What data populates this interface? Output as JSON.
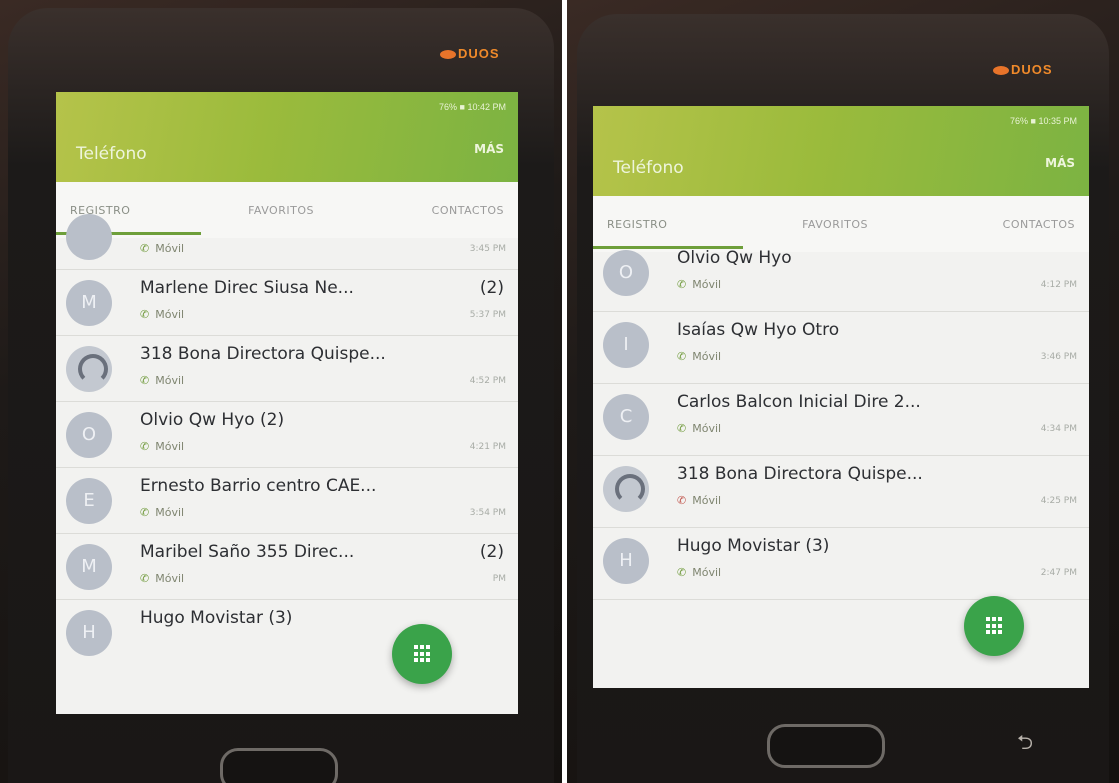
{
  "left_photo": {
    "brand_badge": "DUOS",
    "status_bar": "76% ■ 10:42 PM",
    "app_title": "Teléfono",
    "more_label": "MÁS",
    "tabs": [
      "REGISTRO",
      "FAVORITOS",
      "CONTACTOS"
    ],
    "active_tab": "REGISTRO",
    "entries": [
      {
        "avatar": "",
        "name": "",
        "type": "Móvil",
        "time": "3:45 PM",
        "count": ""
      },
      {
        "avatar": "M",
        "name": "Marlene Direc Siusa Ne...",
        "type": "Móvil",
        "time": "5:37 PM",
        "count": "(2)"
      },
      {
        "avatar": "",
        "name": "318 Bona Directora Quispe...",
        "type": "Móvil",
        "time": "4:52 PM",
        "count": ""
      },
      {
        "avatar": "O",
        "name": "Olvio Qw Hyo (2)",
        "type": "Móvil",
        "time": "4:21 PM",
        "count": ""
      },
      {
        "avatar": "E",
        "name": "Ernesto Barrio centro CAE...",
        "type": "Móvil",
        "time": "3:54 PM",
        "count": ""
      },
      {
        "avatar": "M",
        "name": "Maribel Saño 355 Direc...",
        "type": "Móvil",
        "time": "PM",
        "count": "(2)"
      },
      {
        "avatar": "H",
        "name": "Hugo Movistar (3)",
        "type": "",
        "time": "",
        "count": ""
      }
    ]
  },
  "right_photo": {
    "brand_badge": "DUOS",
    "status_bar": "76% ■ 10:35 PM",
    "app_title": "Teléfono",
    "more_label": "MÁS",
    "tabs": [
      "REGISTRO",
      "FAVORITOS",
      "CONTACTOS"
    ],
    "active_tab": "REGISTRO",
    "entries": [
      {
        "avatar": "O",
        "name": "Olvio Qw Hyo",
        "type": "Móvil",
        "time": "4:12 PM",
        "missed": false
      },
      {
        "avatar": "I",
        "name": "Isaías Qw Hyo Otro",
        "type": "Móvil",
        "time": "3:46 PM",
        "missed": false
      },
      {
        "avatar": "C",
        "name": "Carlos Balcon Inicial Dire 2...",
        "type": "Móvil",
        "time": "4:34 PM",
        "missed": false
      },
      {
        "avatar": "",
        "name": "318 Bona Directora Quispe...",
        "type": "Móvil",
        "time": "4:25 PM",
        "missed": true
      },
      {
        "avatar": "H",
        "name": "Hugo Movistar (3)",
        "type": "Móvil",
        "time": "2:47 PM",
        "missed": false
      }
    ]
  },
  "colors": {
    "app_bar": "#8fb842",
    "fab": "#3aa34a",
    "tab_indicator": "#6e9f3a",
    "missed_call": "#c0534a"
  },
  "icons": {
    "call_icon": "phone-icon",
    "fab_icon": "dialpad-icon",
    "generic_avatar": "person-icon"
  }
}
